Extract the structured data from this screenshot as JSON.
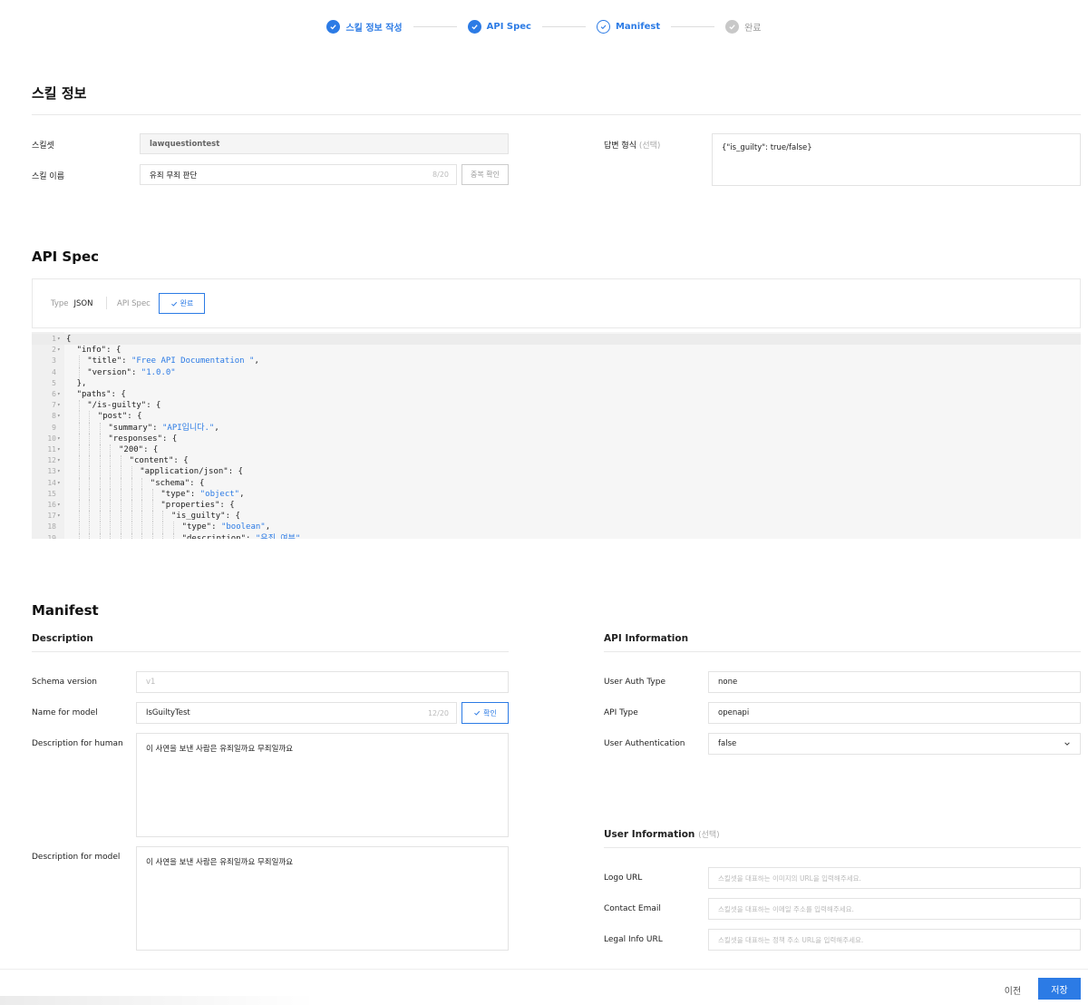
{
  "stepper": {
    "steps": [
      {
        "label": "스킬 정보 작성",
        "state": "done"
      },
      {
        "label": "API Spec",
        "state": "done"
      },
      {
        "label": "Manifest",
        "state": "current"
      },
      {
        "label": "완료",
        "state": "pending"
      }
    ]
  },
  "skill_info": {
    "title": "스킬 정보",
    "skillset_label": "스킬셋",
    "skillset_value": "lawquestiontest",
    "skill_name_label": "스킬 이름",
    "skill_name_value": "유죄 무죄 판단",
    "skill_name_count": "8/20",
    "dup_check_button": "중복 확인",
    "answer_format_label": "답변 형식",
    "answer_format_optional": "(선택)",
    "answer_format_value": "{\"is_guilty\": true/false}"
  },
  "api_spec": {
    "title": "API Spec",
    "type_label": "Type",
    "type_value": "JSON",
    "api_spec_label": "API Spec",
    "done_button": "완료",
    "code_lines": [
      {
        "n": "1",
        "fold": true,
        "indent": 0,
        "parts": [
          [
            "p",
            "{"
          ]
        ]
      },
      {
        "n": "2",
        "fold": true,
        "indent": 1,
        "parts": [
          [
            "p",
            "\"info\": {"
          ]
        ]
      },
      {
        "n": "3",
        "fold": false,
        "indent": 2,
        "parts": [
          [
            "p",
            "\"title\": "
          ],
          [
            "s",
            "\"Free API Documentation \""
          ],
          [
            "p",
            ","
          ]
        ]
      },
      {
        "n": "4",
        "fold": false,
        "indent": 2,
        "parts": [
          [
            "p",
            "\"version\": "
          ],
          [
            "s",
            "\"1.0.0\""
          ]
        ]
      },
      {
        "n": "5",
        "fold": false,
        "indent": 1,
        "parts": [
          [
            "p",
            "},"
          ]
        ]
      },
      {
        "n": "6",
        "fold": true,
        "indent": 1,
        "parts": [
          [
            "p",
            "\"paths\": {"
          ]
        ]
      },
      {
        "n": "7",
        "fold": true,
        "indent": 2,
        "parts": [
          [
            "p",
            "\"/is-guilty\": {"
          ]
        ]
      },
      {
        "n": "8",
        "fold": true,
        "indent": 3,
        "parts": [
          [
            "p",
            "\"post\": {"
          ]
        ]
      },
      {
        "n": "9",
        "fold": false,
        "indent": 4,
        "parts": [
          [
            "p",
            "\"summary\": "
          ],
          [
            "s",
            "\"API입니다.\""
          ],
          [
            "p",
            ","
          ]
        ]
      },
      {
        "n": "10",
        "fold": true,
        "indent": 4,
        "parts": [
          [
            "p",
            "\"responses\": {"
          ]
        ]
      },
      {
        "n": "11",
        "fold": true,
        "indent": 5,
        "parts": [
          [
            "p",
            "\"200\": {"
          ]
        ]
      },
      {
        "n": "12",
        "fold": true,
        "indent": 6,
        "parts": [
          [
            "p",
            "\"content\": {"
          ]
        ]
      },
      {
        "n": "13",
        "fold": true,
        "indent": 7,
        "parts": [
          [
            "p",
            "\"application/json\": {"
          ]
        ]
      },
      {
        "n": "14",
        "fold": true,
        "indent": 8,
        "parts": [
          [
            "p",
            "\"schema\": {"
          ]
        ]
      },
      {
        "n": "15",
        "fold": false,
        "indent": 9,
        "parts": [
          [
            "p",
            "\"type\": "
          ],
          [
            "s",
            "\"object\""
          ],
          [
            "p",
            ","
          ]
        ]
      },
      {
        "n": "16",
        "fold": true,
        "indent": 9,
        "parts": [
          [
            "p",
            "\"properties\": {"
          ]
        ]
      },
      {
        "n": "17",
        "fold": true,
        "indent": 10,
        "parts": [
          [
            "p",
            "\"is_guilty\": {"
          ]
        ]
      },
      {
        "n": "18",
        "fold": false,
        "indent": 11,
        "parts": [
          [
            "p",
            "\"type\": "
          ],
          [
            "s",
            "\"boolean\""
          ],
          [
            "p",
            ","
          ]
        ]
      },
      {
        "n": "19",
        "fold": false,
        "indent": 11,
        "parts": [
          [
            "p",
            "\"description\": "
          ],
          [
            "s",
            "\"유죄 여부\""
          ]
        ]
      }
    ]
  },
  "manifest": {
    "title": "Manifest",
    "description": {
      "title": "Description",
      "schema_version_label": "Schema version",
      "schema_version_value": "v1",
      "name_for_model_label": "Name for model",
      "name_for_model_value": "IsGuiltyTest",
      "name_for_model_count": "12/20",
      "confirm_button": "확인",
      "desc_human_label": "Description for human",
      "desc_human_value": "이 사연을 보낸 사람은 유죄일까요 무죄일까요",
      "desc_model_label": "Description for model",
      "desc_model_value": "이 사연을 보낸 사람은 유죄일까요 무죄일까요"
    },
    "api_information": {
      "title": "API Information",
      "user_auth_type_label": "User Auth Type",
      "user_auth_type_value": "none",
      "api_type_label": "API Type",
      "api_type_value": "openapi",
      "user_authentication_label": "User Authentication",
      "user_authentication_value": "false"
    },
    "user_information": {
      "title": "User Information",
      "optional": "(선택)",
      "logo_url_label": "Logo URL",
      "logo_url_placeholder": "스킬셋을 대표하는 이미지의 URL을 입력해주세요.",
      "contact_email_label": "Contact Email",
      "contact_email_placeholder": "스킬셋을 대표하는 이메일 주소를 입력해주세요.",
      "legal_info_label": "Legal Info URL",
      "legal_info_placeholder": "스킬셋을 대표하는 정책 주소 URL을 입력해주세요."
    }
  },
  "footer": {
    "prev_button": "이전",
    "save_button": "저장"
  },
  "colors": {
    "accent": "#2c7be5",
    "string": "#2c7be5"
  }
}
